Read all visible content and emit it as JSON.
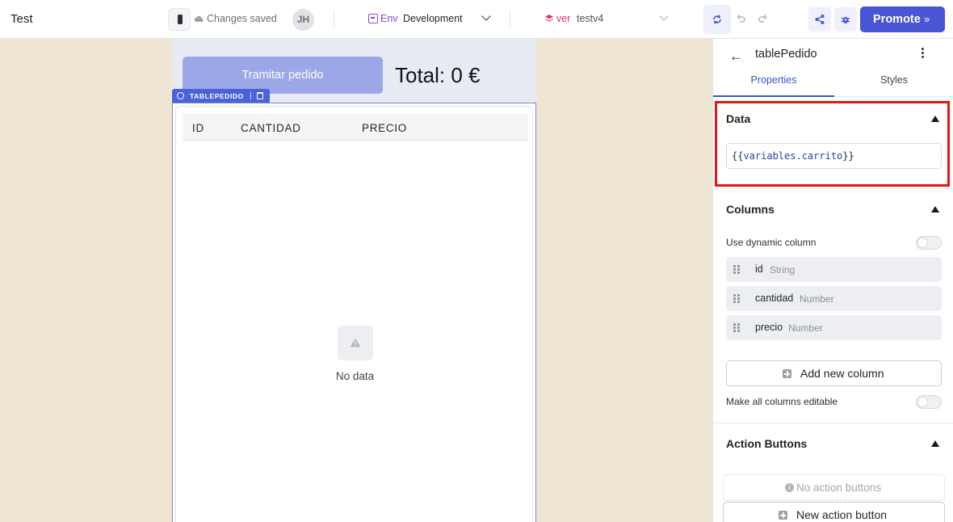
{
  "topbar": {
    "app_title": "Test",
    "save_status": "Changes saved",
    "avatar_initials": "JH",
    "env_label": "Env",
    "env_value": "Development",
    "version_label": "ver",
    "version_value": "testv4",
    "promote_label": "Promote",
    "promote_chevrons": "»"
  },
  "canvas": {
    "button_label": "Tramitar pedido",
    "total_text": "Total: 0 €",
    "component_tag": "TABLEPEDIDO",
    "table": {
      "columns": [
        "ID",
        "CANTIDAD",
        "PRECIO"
      ],
      "empty_text": "No data"
    }
  },
  "panel": {
    "component_name": "tablePedido",
    "tabs": [
      {
        "label": "Properties",
        "active": true
      },
      {
        "label": "Styles",
        "active": false
      }
    ],
    "data_section": {
      "title": "Data",
      "value_open": "{{",
      "value_expr": "variables.carrito",
      "value_close": "}}"
    },
    "columns_section": {
      "title": "Columns",
      "dynamic_label": "Use dynamic column",
      "dynamic_enabled": false,
      "columns": [
        {
          "name": "id",
          "type": "String"
        },
        {
          "name": "cantidad",
          "type": "Number"
        },
        {
          "name": "precio",
          "type": "Number"
        }
      ],
      "add_label": "Add new column",
      "editable_label": "Make all columns editable",
      "editable_enabled": false
    },
    "actions_section": {
      "title": "Action Buttons",
      "empty_label": "No action buttons",
      "new_label": "New action button"
    }
  },
  "colors": {
    "accent": "#4a55d6",
    "env": "#8e44d6",
    "version": "#d6337a",
    "highlight": "#e41515",
    "canvas_bg": "#efe5d3"
  }
}
